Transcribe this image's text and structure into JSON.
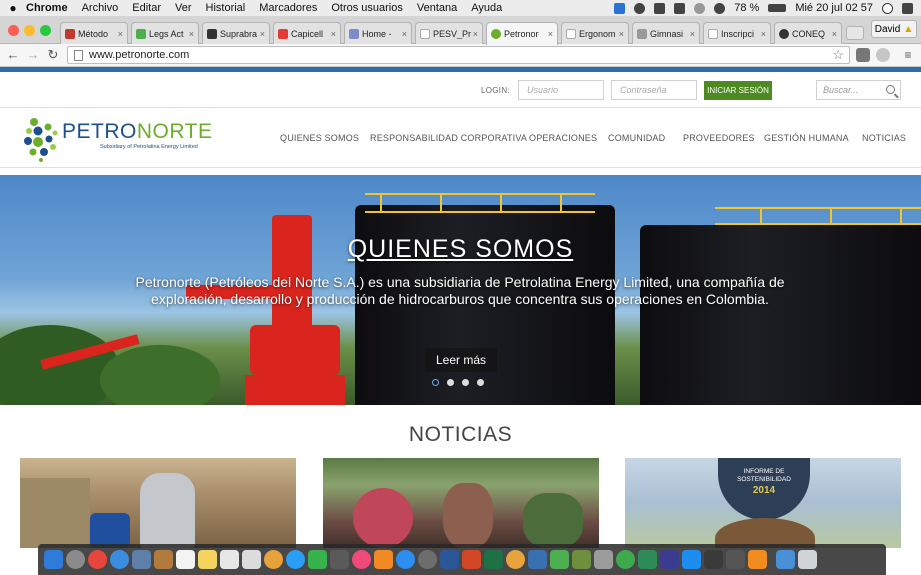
{
  "os_menubar": {
    "app_name": "Chrome",
    "menus": [
      "Archivo",
      "Editar",
      "Ver",
      "Historial",
      "Marcadores",
      "Otros usuarios",
      "Ventana",
      "Ayuda"
    ],
    "battery": "78 %",
    "clock": "Mié 20 jul  02 57"
  },
  "browser": {
    "tabs": [
      {
        "label": "Método",
        "color": "#c0392b"
      },
      {
        "label": "Legs Act",
        "color": "#4caf50"
      },
      {
        "label": "Suprabra",
        "color": "#333333"
      },
      {
        "label": "Capicell",
        "color": "#e53935"
      },
      {
        "label": "Home - ",
        "color": "#7e8cc8"
      },
      {
        "label": "PESV_Pr",
        "color": "#888888"
      },
      {
        "label": "Petronor",
        "color": "#6cae2c"
      },
      {
        "label": "Ergonom",
        "color": "#888888"
      },
      {
        "label": "Gimnasi",
        "color": "#888888"
      },
      {
        "label": "Inscripci",
        "color": "#888888"
      },
      {
        "label": "CONEQ",
        "color": "#333333"
      }
    ],
    "tab_close": "×",
    "profile_name": "David",
    "url": "www.petronorte.com"
  },
  "site": {
    "login": {
      "label": "LOGIN:",
      "user_placeholder": "Usuario",
      "password_placeholder": "Contraseña",
      "submit_label": "INICIAR SESIÓN",
      "search_placeholder": "Buscar..."
    },
    "logo": {
      "part1": "PETRO",
      "part2": "NORTE",
      "subtitle": "Subsidiary of Petrolatina Energy Limited"
    },
    "nav": [
      "QUIENES SOMOS",
      "RESPONSABILIDAD CORPORATIVA",
      "OPERACIONES",
      "COMUNIDAD",
      "PROVEEDORES",
      "GESTIÓN HUMANA",
      "NOTICIAS"
    ],
    "hero": {
      "title": "QUIENES SOMOS",
      "text": "Petronorte (Petróleos del Norte S.A.) es una subsidiaria de Petrolatina Energy Limited, una compañía de exploración, desarrollo y producción de hidrocarburos  que concentra sus operaciones en Colombia.",
      "button": "Leer más",
      "slides": 4,
      "active_slide": 1
    },
    "news": {
      "title": "NOTICIAS",
      "report_line1": "INFORME DE",
      "report_line2": "SOSTENIBILIDAD",
      "report_year": "2014"
    }
  },
  "colors": {
    "brand_blue": "#1d4f8c",
    "brand_green": "#6cae2c",
    "login_button": "#4e8a22",
    "top_bar": "#2a6da8"
  }
}
